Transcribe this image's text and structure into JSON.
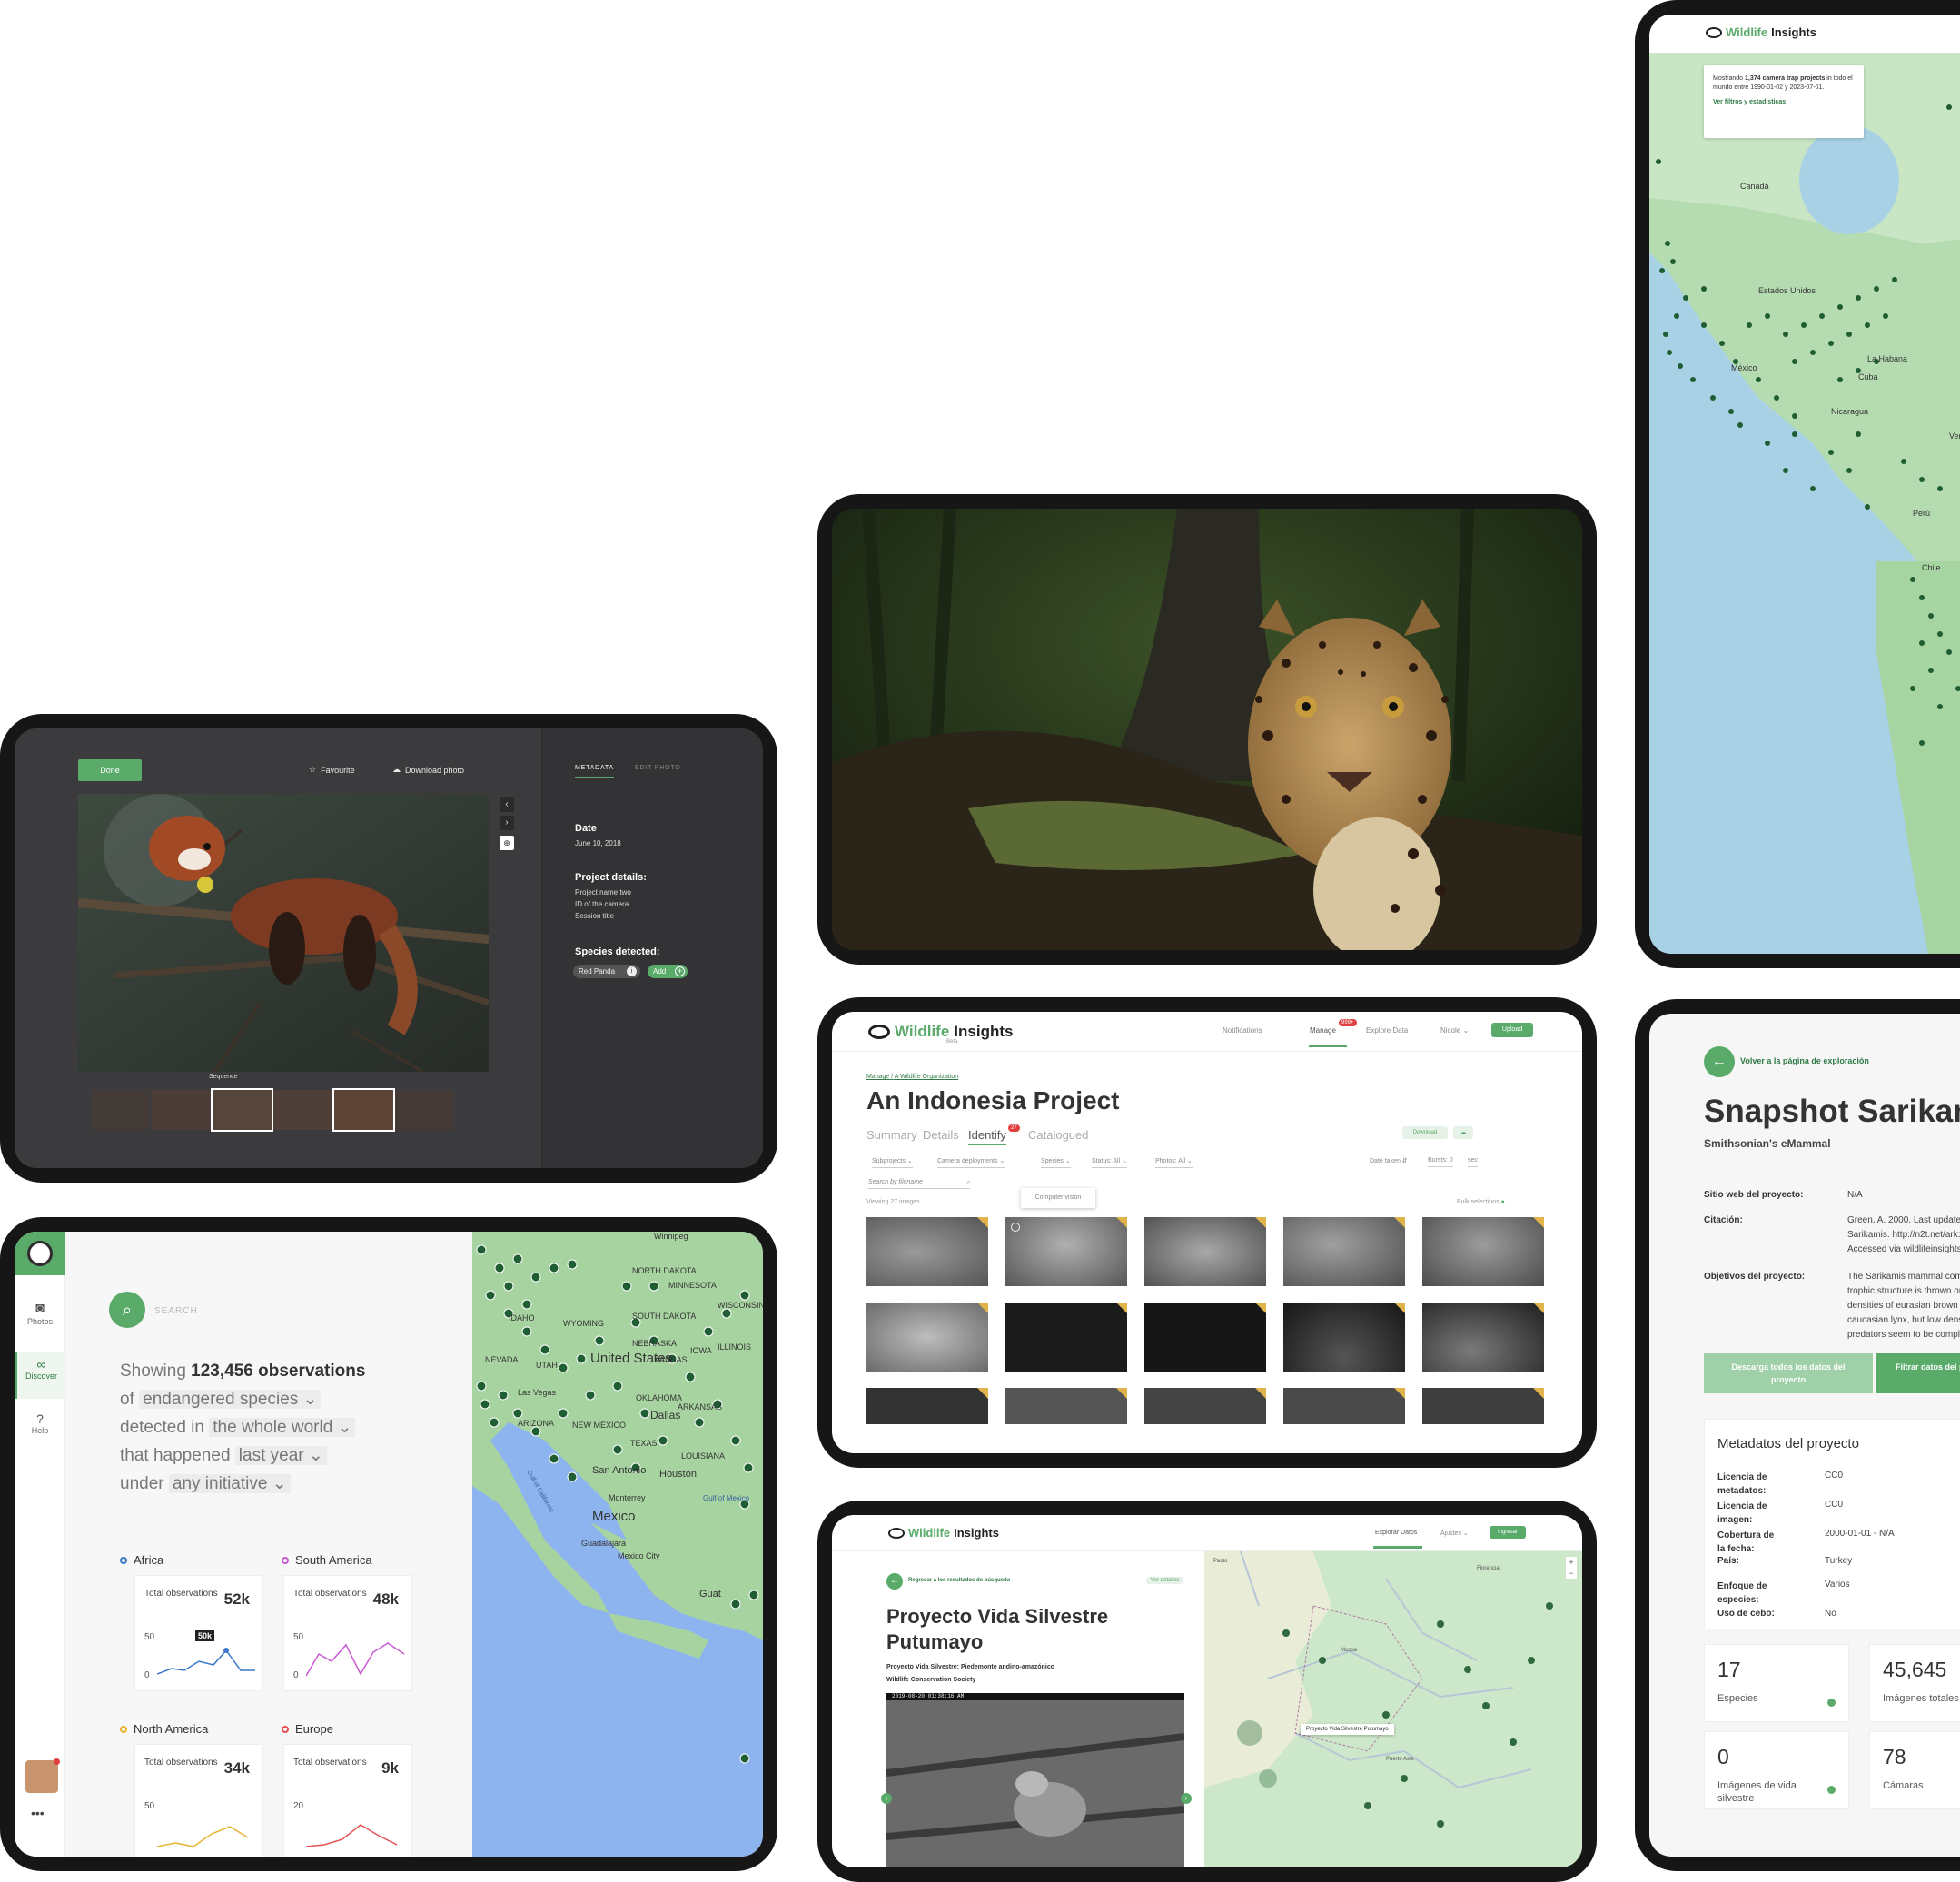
{
  "panda": {
    "done": "Done",
    "favourite": "Favourite",
    "download": "Download photo",
    "tab_metadata": "METADATA",
    "tab_edit": "EDIT PHOTO",
    "date_h": "Date",
    "date_v": "June 10, 2018",
    "project_h": "Project details:",
    "project_lines": [
      "Project name two",
      "ID of the camera",
      "Session title"
    ],
    "species_h": "Species detected:",
    "species_chip": "Red Panda",
    "add": "Add",
    "sequence": "Sequence"
  },
  "map_right": {
    "logo_a": "Wildlife",
    "logo_b": " Insights",
    "info_pre": "Mostrando ",
    "info_bold": "1,374 camera trap projects",
    "info_post": " in todo el mundo entre 1990-01-02 y 2023-07-01.",
    "info_link": "Ver filtros y estadísticas",
    "labels": [
      "Canadá",
      "Estados Unidos",
      "México",
      "Cuba",
      "Venezuela",
      "Perú",
      "Chile",
      "Nicaragua",
      "La Habana"
    ]
  },
  "indonesia": {
    "logo_a": "Wildlife",
    "logo_b": " Insights",
    "beta": "Beta",
    "nav": [
      "Notifications",
      "Manage",
      "Explore Data",
      "Nicole"
    ],
    "badge": "999+",
    "upload": "Upload",
    "crumb_1": "Manage",
    "crumb_sep": "/",
    "crumb_2": "A Wildlife Organization",
    "title": "An Indonesia Project",
    "tabs": [
      "Summary",
      "Details",
      "Identify",
      "Catalogued"
    ],
    "identify_badge": "27",
    "download": "Download",
    "filters": [
      "Subprojects",
      "Camera deployments",
      "Species",
      "Status: All",
      "Photos: All"
    ],
    "date_taken": "Date taken",
    "bursts": "Bursts: 0",
    "sec": "sec",
    "search_ph": "Search by filename",
    "viewing": "Viewing 27 images",
    "tooltip": "Computer vision",
    "bulk": "Bulk selections"
  },
  "obs": {
    "nav": [
      "Photos",
      "Discover",
      "Help"
    ],
    "search": "SEARCH",
    "line1_pre": "Showing ",
    "line1_bold": "123,456 observations",
    "line2_pre": "of ",
    "line2_dd": "endangered species",
    "line3_pre": "detected in ",
    "line3_dd": "the whole world",
    "line4_pre": "that happened ",
    "line4_dd": "last year",
    "line5_pre": "under ",
    "line5_dd": "any initiative",
    "regions": [
      {
        "name": "Africa",
        "total": "52k",
        "top": "50",
        "zero": "0",
        "tip": "50k",
        "color": "#3c78c8"
      },
      {
        "name": "South America",
        "total": "48k",
        "top": "50",
        "zero": "0",
        "color": "#c85ad2"
      },
      {
        "name": "North America",
        "total": "34k",
        "top": "50",
        "color": "#e6b432"
      },
      {
        "name": "Europe",
        "total": "9k",
        "top": "20",
        "color": "#e65050"
      }
    ],
    "card_label": "Total observations",
    "map_labels": [
      "Winnipeg",
      "NORTH DAKOTA",
      "SOUTH DAKOTA",
      "MINNESOTA",
      "WISCONSIN",
      "IDAHO",
      "WYOMING",
      "NEBRASKA",
      "IOWA",
      "ILLINOIS",
      "NEVADA",
      "UTAH",
      "KANSAS",
      "Las Vegas",
      "ARIZONA",
      "NEW MEXICO",
      "OKLAHOMA",
      "ARKANSAS",
      "Dallas",
      "TEXAS",
      "LOUISIANA",
      "San Antonio",
      "Houston",
      "Monterrey",
      "Mexico",
      "Guadalajara",
      "Mexico City",
      "Gulf of Mexico",
      "Gulf of California",
      "United States",
      "Guat"
    ]
  },
  "putumayo": {
    "logo_a": "Wildlife",
    "logo_b": " Insights",
    "nav": [
      "Explorar Datos",
      "Ajustes",
      "Ingresar"
    ],
    "back": "Regresar a los resultados de búsqueda",
    "details": "Ver detalles",
    "title": "Proyecto Vida Silvestre Putumayo",
    "sub1": "Proyecto Vida Silvestre: Piedemonte andino-amazónico",
    "sub2": "Wildlife Conservation Society",
    "map_tip": "Proyecto Vida Silvestre Putumayo",
    "stamp": "2019-08-20 01:38:16 AM"
  },
  "snapshot": {
    "back": "Volver a la página de exploración",
    "title": "Snapshot Sarikamis",
    "org": "Smithsonian's eMammal",
    "rows": [
      {
        "k": "Sitio web del proyecto:",
        "v": [
          "N/A"
        ]
      },
      {
        "k": "Citación:",
        "v": [
          "Green, A. 2000. Last updated f",
          "Sarikamis. http://n2t.net/ark:/",
          "Accessed via wildlifeinsights."
        ]
      },
      {
        "k": "Objetivos del proyecto:",
        "v": [
          "The Sarikamis mammal comm",
          "trophic structure is thrown on",
          "densities of eurasian brown be",
          "caucasian lynx, but low densit",
          "predators seem to be complet"
        ]
      }
    ],
    "btn_download": "Descarga todos los datos del proyecto",
    "btn_filter": "Filtrar datos del proyecto",
    "meta_title": "Metadatos del proyecto",
    "meta": [
      {
        "k": "Licencia de metadatos:",
        "v": "CC0"
      },
      {
        "k": "Licencia de imagen:",
        "v": "CC0"
      },
      {
        "k": "Cobertura de la fecha:",
        "v": "2000-01-01 - N/A"
      },
      {
        "k": "País:",
        "v": "Turkey"
      },
      {
        "k": "Enfoque de especies:",
        "v": "Varios"
      },
      {
        "k": "Uso de cebo:",
        "v": "No"
      }
    ],
    "stats": [
      {
        "n": "17",
        "l": "Especies"
      },
      {
        "n": "45,645",
        "l": "Imágenes totales"
      },
      {
        "n": "0",
        "l": "Imágenes de vida silvestre"
      },
      {
        "n": "78",
        "l": "Cámaras"
      }
    ]
  },
  "colors": {
    "accent": "#5aaa6a",
    "frame": "#161616",
    "dark_panel": "#3b3b3d",
    "badge": "#e04040",
    "flag": "#e1b34b"
  }
}
